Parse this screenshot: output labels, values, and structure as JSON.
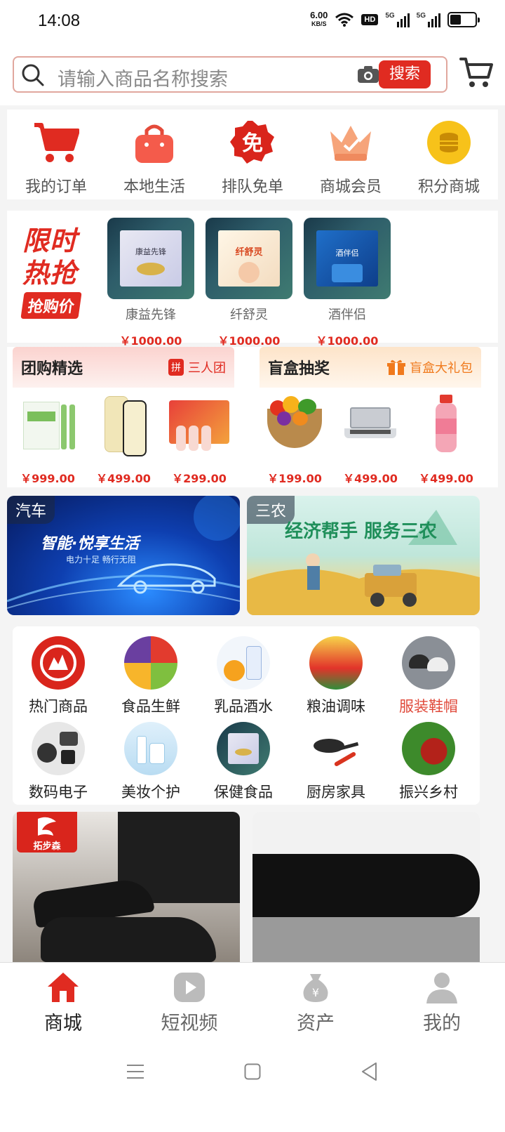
{
  "status": {
    "time": "14:08",
    "net_speed": "6.00",
    "net_unit": "KB/S",
    "hd_label": "HD",
    "signal1": "5G",
    "signal2": "5G",
    "battery_level": 0.45
  },
  "search": {
    "placeholder": "请输入商品名称搜索",
    "button": "搜索"
  },
  "quick_nav": [
    {
      "label": "我的订单",
      "icon": "cart-icon"
    },
    {
      "label": "本地生活",
      "icon": "bag-icon"
    },
    {
      "label": "排队免单",
      "icon": "free-badge-icon",
      "badge": "免"
    },
    {
      "label": "商城会员",
      "icon": "crown-icon"
    },
    {
      "label": "积分商城",
      "icon": "coin-icon"
    }
  ],
  "flash_sale": {
    "title1": "限时",
    "title2": "热抢",
    "tag": "抢购价",
    "products": [
      {
        "name": "康益先锋",
        "price": "￥1000.00",
        "box_text": "康益先锋"
      },
      {
        "name": "纤舒灵",
        "price": "￥1000.00",
        "box_text": "纤舒灵"
      },
      {
        "name": "酒伴侣",
        "price": "￥1000.00",
        "box_text": "酒伴侣"
      }
    ]
  },
  "group_buy": {
    "title": "团购精选",
    "subtitle": "三人团",
    "badge": "拼",
    "items": [
      {
        "price": "￥999.00"
      },
      {
        "price": "￥499.00"
      },
      {
        "price": "￥299.00"
      }
    ]
  },
  "blind_box": {
    "title": "盲盒抽奖",
    "subtitle": "盲盒大礼包",
    "items": [
      {
        "price": "￥199.00"
      },
      {
        "price": "￥499.00"
      },
      {
        "price": "￥499.00"
      }
    ]
  },
  "banners": [
    {
      "tab": "汽车",
      "slogan": "智能·悦享生活",
      "sub": "电力十足 畅行无阻"
    },
    {
      "tab": "三农",
      "slogan": "经济帮手 服务三农"
    }
  ],
  "categories": [
    {
      "label": "热门商品",
      "icon": "hot-icon"
    },
    {
      "label": "食品生鲜",
      "icon": "fresh-food-icon"
    },
    {
      "label": "乳品酒水",
      "icon": "dairy-icon"
    },
    {
      "label": "粮油调味",
      "icon": "grain-oil-icon"
    },
    {
      "label": "服装鞋帽",
      "icon": "clothing-icon",
      "highlight": "#e04a3b"
    },
    {
      "label": "数码电子",
      "icon": "digital-icon"
    },
    {
      "label": "美妆个护",
      "icon": "beauty-icon"
    },
    {
      "label": "保健食品",
      "icon": "health-food-icon"
    },
    {
      "label": "厨房家具",
      "icon": "kitchen-icon"
    },
    {
      "label": "振兴乡村",
      "icon": "village-icon"
    }
  ],
  "feed": {
    "brand": "拓步森"
  },
  "bottom_nav": [
    {
      "label": "商城",
      "icon": "home-icon",
      "active": true
    },
    {
      "label": "短视频",
      "icon": "video-icon"
    },
    {
      "label": "资产",
      "icon": "money-bag-icon"
    },
    {
      "label": "我的",
      "icon": "user-icon"
    }
  ],
  "colors": {
    "primary": "#e02b21",
    "background": "#f4f4f4"
  }
}
